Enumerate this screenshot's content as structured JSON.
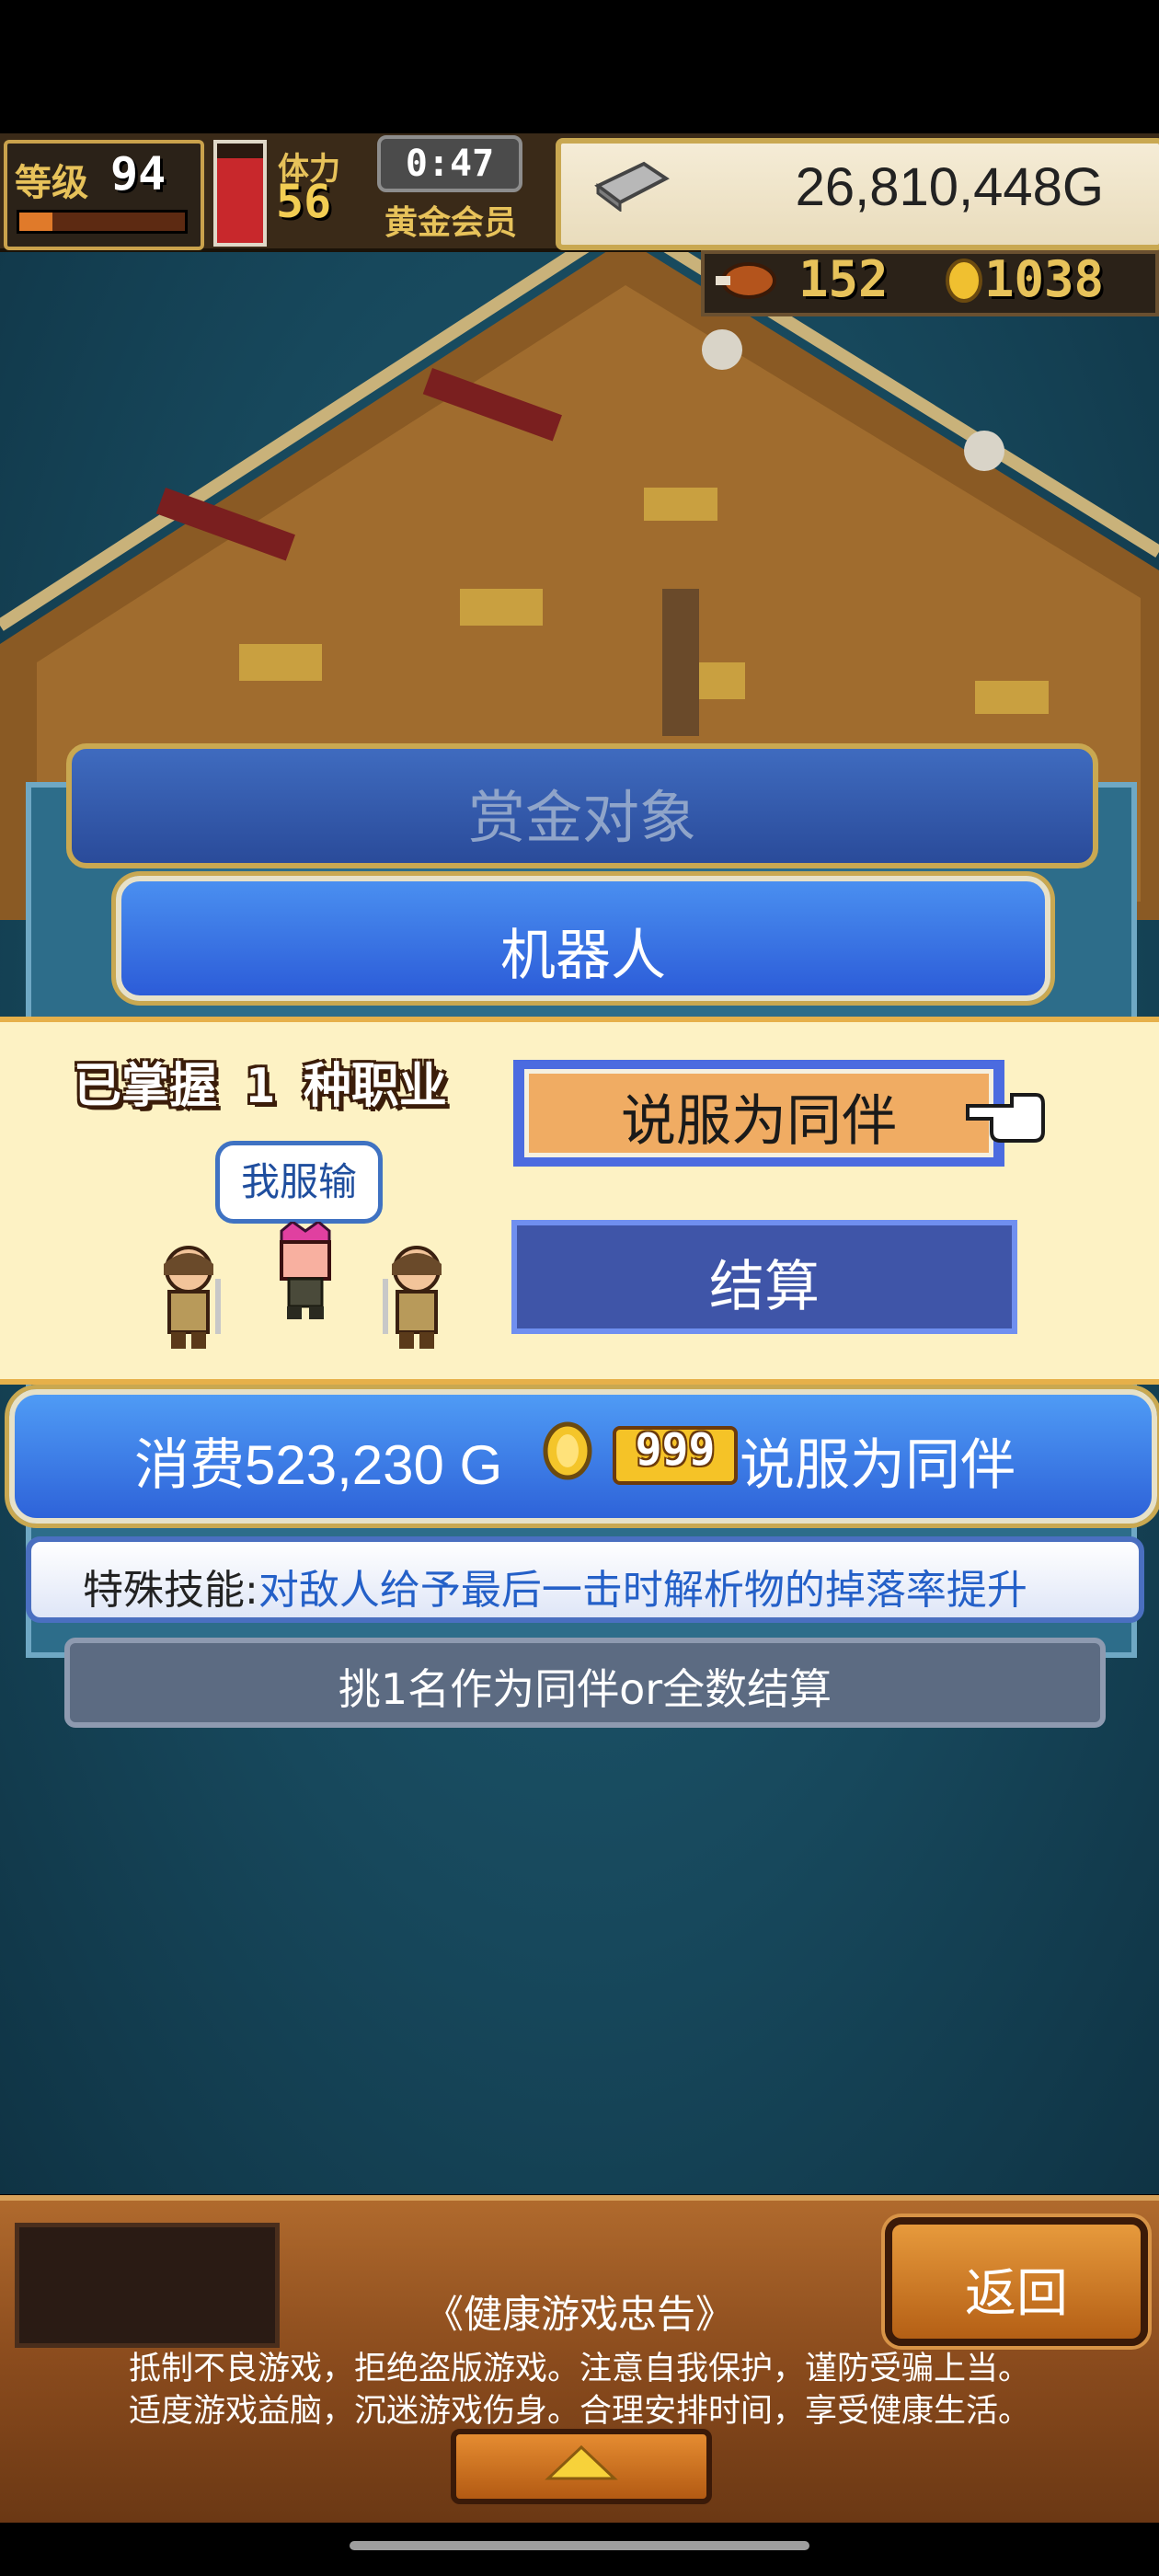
{
  "hud": {
    "level_label": "等级",
    "level": "94",
    "level_progress": 0.2,
    "stamina_fraction": 0.85,
    "stamina_label": "体力",
    "stamina": "56",
    "timer": "0:47",
    "membership": "黄金会员",
    "money": "26,810,448G",
    "meat": "152",
    "coins": "1038"
  },
  "bounty": {
    "title": "赏金对象",
    "target": "机器人"
  },
  "recruit": {
    "mastered": "已掌握 1 种职业",
    "bubble": "我服输",
    "recruit_label": "说服为同伴",
    "settle_label": "结算"
  },
  "cost": {
    "text": "消费523,230 G",
    "gem_count": "999",
    "action": "说服为同伴"
  },
  "skill": {
    "label": "特殊技能:",
    "desc": "对敌人给予最后一击时解析物的掉落率提升"
  },
  "hint": "挑1名作为同伴or全数结算",
  "bottom": {
    "back_label": "返回",
    "health_title": "《健康游戏忠告》",
    "health_line1": "抵制不良游戏，拒绝盗版游戏。注意自我保护，谨防受骗上当。",
    "health_line2": "适度游戏益脑，沉迷游戏伤身。合理安排时间，享受健康生活。"
  },
  "colors": {
    "gold": "#c9a851",
    "sea": "#1f5e74",
    "recruit_button": "#f0ac63",
    "skill_desc": "#2460c8"
  }
}
